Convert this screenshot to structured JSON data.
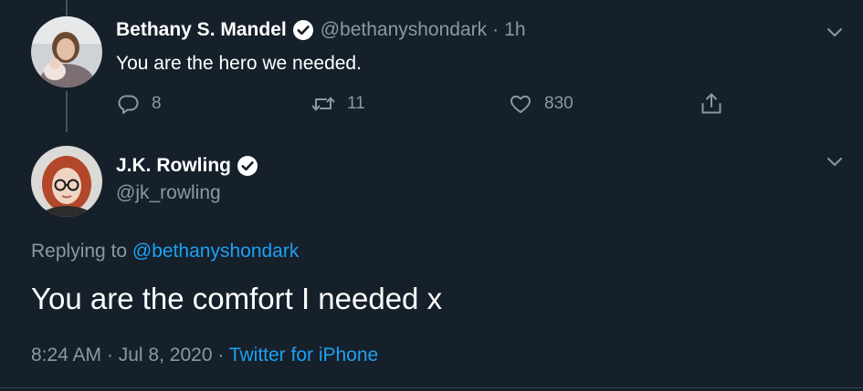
{
  "tweet1": {
    "display_name": "Bethany S. Mandel",
    "handle": "@bethanyshondark",
    "separator": "·",
    "time": "1h",
    "text": "You are the hero we needed.",
    "actions": {
      "replies": "8",
      "retweets": "11",
      "likes": "830"
    },
    "icons": {
      "avatar": "avatar-photo",
      "verified": "verified-badge-icon",
      "menu": "chevron-down-icon",
      "reply": "reply-bubble-icon",
      "retweet": "retweet-icon",
      "like": "heart-icon",
      "share": "share-icon"
    }
  },
  "tweet2": {
    "display_name": "J.K. Rowling",
    "handle": "@jk_rowling",
    "replying_prefix": "Replying to",
    "replying_to": "@bethanyshondark",
    "text": "You are the comfort I needed x",
    "timestamp_time": "8:24 AM",
    "separator": "·",
    "timestamp_date": "Jul 8, 2020",
    "source": "Twitter for iPhone",
    "icons": {
      "avatar": "avatar-photo",
      "verified": "verified-badge-icon",
      "menu": "chevron-down-icon"
    }
  },
  "colors": {
    "background": "#15202b",
    "primary_text": "#ffffff",
    "secondary_text": "#8899a6",
    "link": "#1da1f2",
    "thread_line": "#3d5466"
  }
}
